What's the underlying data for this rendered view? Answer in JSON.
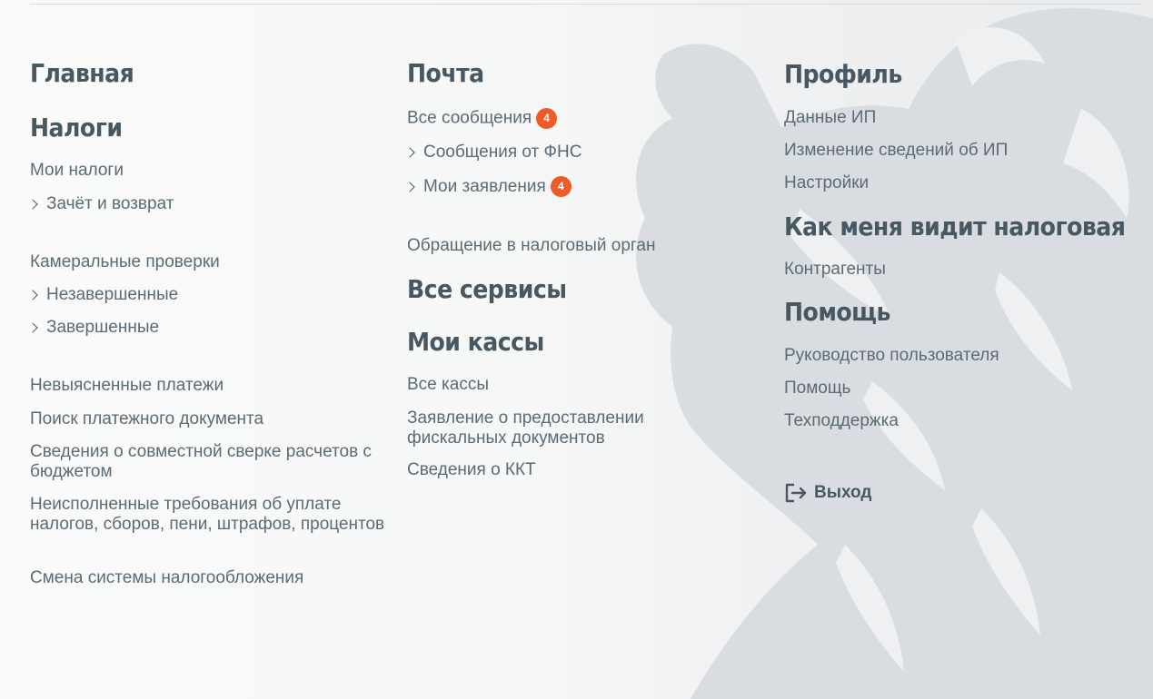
{
  "col1": {
    "home": "Главная",
    "taxes": "Налоги",
    "my_taxes": "Мои налоги",
    "offset_refund": "Зачёт и возврат",
    "desk_audits": "Камеральные проверки",
    "unfinished": "Незавершенные",
    "finished": "Завершенные",
    "unclear_payments": "Невыясненные платежи",
    "payment_search": "Поиск платежного документа",
    "reconciliation": "Сведения о совместной сверке расчетов с бюджетом",
    "unfulfilled": "Неисполненные требования об уплате налогов, сборов, пени, штрафов, процентов",
    "tax_system_change": "Смена системы налогообложения"
  },
  "col2": {
    "mail": "Почта",
    "all_messages": "Все сообщения",
    "all_messages_badge": "4",
    "fns_messages": "Сообщения от ФНС",
    "my_applications": "Мои заявления",
    "my_applications_badge": "4",
    "appeal": "Обращение в налоговый орган",
    "all_services": "Все сервисы",
    "my_registers": "Мои кассы",
    "all_registers": "Все кассы",
    "fiscal_docs": "Заявление о предоставлении фискальных документов",
    "kkt_info": "Сведения о ККТ"
  },
  "col3": {
    "profile": "Профиль",
    "ip_data": "Данные ИП",
    "ip_changes": "Изменение сведений об ИП",
    "settings": "Настройки",
    "tax_view": "Как меня видит налоговая",
    "counterparties": "Контрагенты",
    "help_heading": "Помощь",
    "user_guide": "Руководство пользователя",
    "help": "Помощь",
    "support": "Техподдержка",
    "logout": "Выход"
  },
  "colors": {
    "badge": "#ef5b28",
    "heading": "#485863",
    "link": "#5b6b75"
  }
}
